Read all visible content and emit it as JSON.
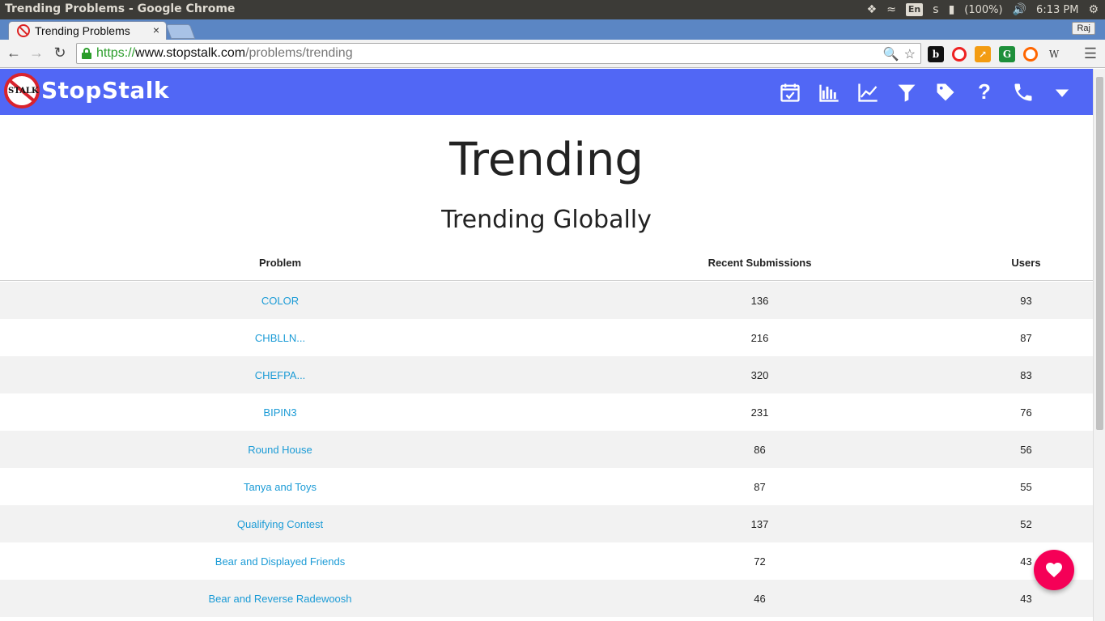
{
  "os": {
    "window_title": "Trending Problems - Google Chrome",
    "lang": "En",
    "battery": "(100%)",
    "time": "6:13 PM"
  },
  "browser": {
    "tab_title": "Trending Problems",
    "tab_close": "×",
    "profile": "Raj",
    "url_scheme": "https://",
    "url_host": "www.stopstalk.com",
    "url_path": "/problems/trending"
  },
  "site": {
    "brand": "StopStalk",
    "logo_text": "STALK",
    "nav": [
      "calendar-check-icon",
      "bar-chart-icon",
      "line-chart-icon",
      "filter-icon",
      "tag-icon",
      "help-icon",
      "phone-icon",
      "caret-down-icon"
    ],
    "accent": "#5167f5",
    "link_color": "#1b9bd6",
    "fab_color": "#f50057"
  },
  "page": {
    "title": "Trending",
    "subtitle": "Trending Globally"
  },
  "table": {
    "headers": {
      "problem": "Problem",
      "submissions": "Recent Submissions",
      "users": "Users"
    },
    "rows": [
      {
        "problem": "COLOR",
        "submissions": "136",
        "users": "93"
      },
      {
        "problem": "CHBLLN...",
        "submissions": "216",
        "users": "87"
      },
      {
        "problem": "CHEFPA...",
        "submissions": "320",
        "users": "83"
      },
      {
        "problem": "BIPIN3",
        "submissions": "231",
        "users": "76"
      },
      {
        "problem": "Round House",
        "submissions": "86",
        "users": "56"
      },
      {
        "problem": "Tanya and Toys",
        "submissions": "87",
        "users": "55"
      },
      {
        "problem": "Qualifying Contest",
        "submissions": "137",
        "users": "52"
      },
      {
        "problem": "Bear and Displayed Friends",
        "submissions": "72",
        "users": "43"
      },
      {
        "problem": "Bear and Reverse Radewoosh",
        "submissions": "46",
        "users": "43"
      }
    ]
  }
}
